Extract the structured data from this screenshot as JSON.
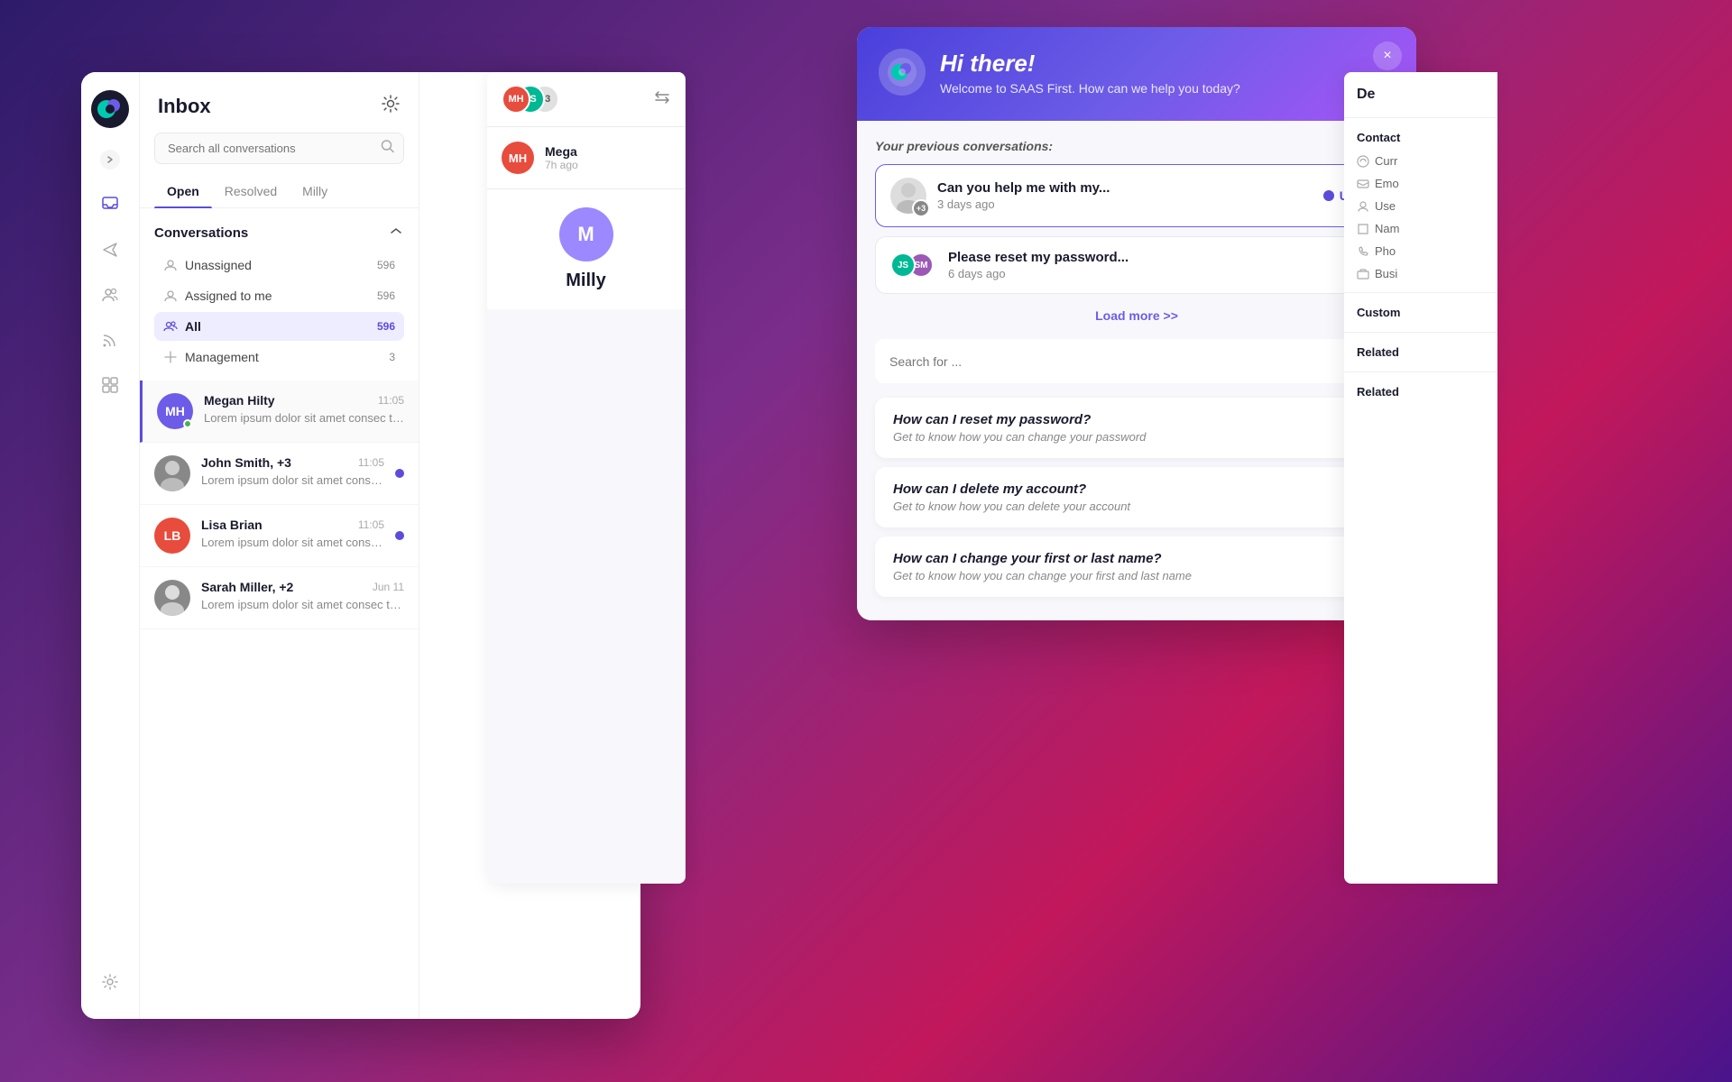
{
  "app": {
    "title": "Inbox"
  },
  "sidebar": {
    "logo_initials": "S",
    "icons": [
      "inbox",
      "send",
      "users",
      "feed",
      "grid",
      "settings"
    ]
  },
  "inbox": {
    "title": "Inbox",
    "search_placeholder": "Search all conversations",
    "tabs": [
      {
        "id": "open",
        "label": "Open",
        "active": true
      },
      {
        "id": "resolved",
        "label": "Resolved",
        "active": false
      },
      {
        "id": "milly",
        "label": "Milly",
        "active": false
      }
    ],
    "conversations_section": {
      "title": "Conversations",
      "items": [
        {
          "id": "unassigned",
          "label": "Unassigned",
          "count": "596",
          "active": false
        },
        {
          "id": "assigned",
          "label": "Assigned to me",
          "count": "596",
          "active": false
        },
        {
          "id": "all",
          "label": "All",
          "count": "596",
          "active": true
        },
        {
          "id": "management",
          "label": "Management",
          "count": "3",
          "active": false
        }
      ]
    },
    "messages": [
      {
        "id": "megan",
        "name": "Megan Hilty",
        "time": "11:05",
        "preview": "Lorem ipsum dolor sit amet consec tetur. Sed erat ipsum...",
        "avatar_bg": "#6c5ce7",
        "initials": "MH",
        "online": true,
        "unread": false,
        "active": true
      },
      {
        "id": "john",
        "name": "John Smith, +3",
        "time": "11:05",
        "preview": "Lorem ipsum dolor sit amet consec tetur. Sed erat ipsum...",
        "avatar_img": true,
        "avatar_bg": "#888",
        "initials": "JS",
        "online": false,
        "unread": true,
        "active": false
      },
      {
        "id": "lisa",
        "name": "Lisa Brian",
        "time": "11:05",
        "preview": "Lorem ipsum dolor sit amet consec tetur. Sed erat ipsum...",
        "avatar_bg": "#e74c3c",
        "initials": "LB",
        "online": false,
        "unread": true,
        "active": false
      },
      {
        "id": "sarah",
        "name": "Sarah Miller, +2",
        "time": "Jun 11",
        "preview": "Lorem ipsum dolor sit amet consec tetur. Sed erat ipsum...",
        "avatar_img": true,
        "avatar_bg": "#888",
        "initials": "SM",
        "online": false,
        "unread": false,
        "active": false
      }
    ]
  },
  "conv_header": {
    "user_name": "Mega",
    "time": "7h ago",
    "avatar_bg": "#e74c3c",
    "initials": "MH",
    "group_avatars": [
      {
        "bg": "#e74c3c",
        "initials": "MH"
      },
      {
        "bg": "#00b894",
        "initials": "JS"
      }
    ],
    "extra_count": "+3"
  },
  "user_profile": {
    "name": "Milly",
    "avatar_bg": "#9c88ff",
    "initials": "M"
  },
  "chat_widget": {
    "header": {
      "title": "Hi there!",
      "subtitle": "Welcome to SAAS First. How can we help you today?",
      "close_label": "×"
    },
    "prev_conversations_label": "Your previous conversations:",
    "conversations": [
      {
        "id": "conv1",
        "text": "Can you help me with my...",
        "time": "3 days ago",
        "status": "Unread",
        "has_unread": true,
        "avatar_count": "+3"
      },
      {
        "id": "conv2",
        "text": "Please reset my password...",
        "time": "6 days ago",
        "status": null,
        "has_unread": false
      }
    ],
    "load_more": "Load more >>",
    "search_placeholder": "Search for ...",
    "faqs": [
      {
        "id": "faq1",
        "title": "How can I reset my password?",
        "subtitle": "Get to know how you can change your password"
      },
      {
        "id": "faq2",
        "title": "How can I delete my account?",
        "subtitle": "Get to know how you can delete your account"
      },
      {
        "id": "faq3",
        "title": "How can I change your first or last name?",
        "subtitle": "Get to know how you can change your first and last name"
      }
    ]
  },
  "right_panel": {
    "section_de": "De",
    "sections": [
      {
        "label": "Contact",
        "icon": "contact"
      },
      {
        "label": "Curr",
        "icon": "clock"
      },
      {
        "label": "Emo",
        "icon": "email"
      },
      {
        "label": "Use",
        "icon": "user"
      },
      {
        "label": "Nam",
        "icon": "name"
      },
      {
        "label": "Pho",
        "icon": "phone"
      },
      {
        "label": "Busi",
        "icon": "business"
      }
    ],
    "custom_label": "Custom",
    "related_label": "Related",
    "related_label2": "Related"
  }
}
